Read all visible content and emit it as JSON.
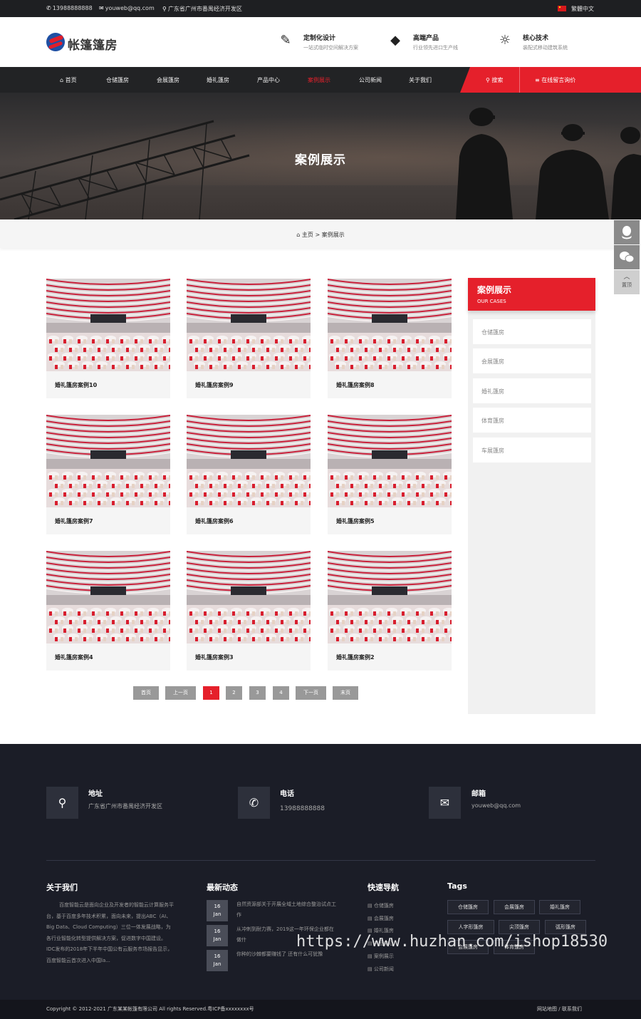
{
  "topbar": {
    "phone": "13988888888",
    "email": "youweb@qq.com",
    "address": "广东省广州市番禺经济开发区",
    "lang": "繁體中文"
  },
  "header": {
    "logo_text": "帐篷篷房",
    "features": [
      {
        "title": "定制化设计",
        "sub": "一站式临时空间解决方案",
        "icon": "pencil-ruler-icon"
      },
      {
        "title": "高端产品",
        "sub": "行业领先进口生产线",
        "icon": "diamond-icon"
      },
      {
        "title": "核心技术",
        "sub": "装配式移动建筑系统",
        "icon": "lightbulb-icon"
      }
    ]
  },
  "nav": {
    "items": [
      "首页",
      "仓储篷房",
      "会展篷房",
      "婚礼篷房",
      "产品中心",
      "案例展示",
      "公司新闻",
      "关于我们"
    ],
    "active": "案例展示",
    "search": "搜索",
    "message": "在线留言询价"
  },
  "banner": {
    "title": "案例展示"
  },
  "breadcrumb": {
    "home": "主页",
    "sep": ">",
    "current": "案例展示"
  },
  "cases": [
    "婚礼篷房案例10",
    "婚礼篷房案例9",
    "婚礼篷房案例8",
    "婚礼篷房案例7",
    "婚礼篷房案例6",
    "婚礼篷房案例5",
    "婚礼篷房案例4",
    "婚礼篷房案例3",
    "婚礼篷房案例2"
  ],
  "pager": {
    "first": "首页",
    "prev": "上一页",
    "pages": [
      "1",
      "2",
      "3",
      "4"
    ],
    "current": "1",
    "next": "下一页",
    "last": "末页"
  },
  "sidebar": {
    "title": "案例展示",
    "subtitle": "OUR CASES",
    "items": [
      "仓储篷房",
      "会展篷房",
      "婚礼篷房",
      "体育篷房",
      "车展篷房"
    ]
  },
  "float_tools": {
    "top_label": "置顶"
  },
  "footer": {
    "contacts": [
      {
        "title": "地址",
        "value": "广东省广州市番禺经济开发区"
      },
      {
        "title": "电话",
        "value": "13988888888"
      },
      {
        "title": "邮箱",
        "value": "youweb@qq.com"
      }
    ],
    "about_title": "关于我们",
    "about_text": "百度智能云是面向企业及开发者的智能云计算服务平台，基于百度多年技术积累，面向未来，提出ABC（AI、Big Data、Cloud Computing）三位一体发展战略，为各行业智能化转型提供解决方案，促进数字中国建设。IDC发布的2018年下半年中国公有云服务市场报告显示，百度智能云首次进入中国la...",
    "news_title": "最新动态",
    "news": [
      {
        "day": "16",
        "month": "Jan",
        "text": "自然资源部关于开展全域土地综合整治试点工作"
      },
      {
        "day": "16",
        "month": "Jan",
        "text": "从冲刺到耐力赛，2019这一年环保企业都在做什"
      },
      {
        "day": "16",
        "month": "Jan",
        "text": "你种的沙棘都要赚钱了 还有什么可犹豫"
      }
    ],
    "quick_title": "快速导航",
    "quick": [
      "仓储篷房",
      "会展篷房",
      "婚礼篷房",
      "产品中心",
      "案例展示",
      "公司新闻"
    ],
    "tags_title": "Tags",
    "tags": [
      "仓储篷房",
      "会展篷房",
      "婚礼篷房",
      "人字形篷房",
      "尖顶篷房",
      "弧形篷房",
      "会展篷房",
      "体育篷房"
    ],
    "copyright": "Copyright © 2012-2021 广东某某帐篷有限公司 All rights Reserved.粤ICP备xxxxxxxx号",
    "links": [
      "网站地图",
      "/",
      "联系我们"
    ]
  },
  "watermark": "https://www.huzhan.com/ishop18530",
  "colors": {
    "accent": "#e5202b",
    "dark": "#222325",
    "footer": "#1b1d27"
  }
}
